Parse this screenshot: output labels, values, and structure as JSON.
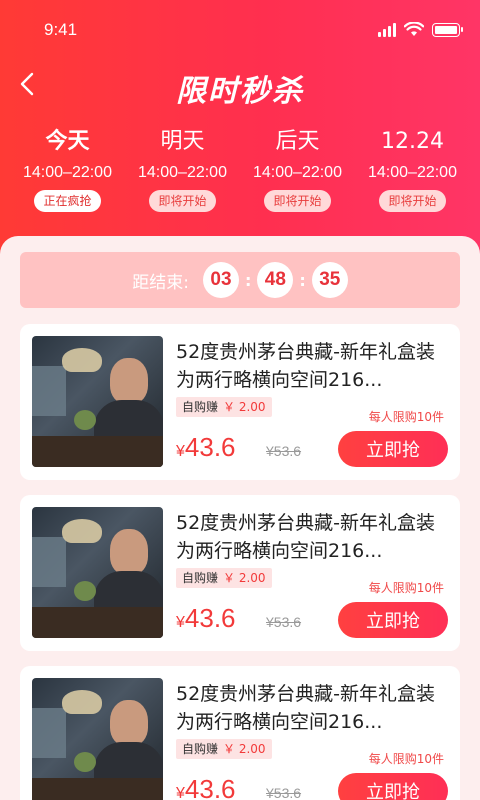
{
  "status_bar": {
    "time": "9:41"
  },
  "nav": {
    "title": "限时秒杀",
    "back_icon": "chevron-left-icon"
  },
  "date_tabs": [
    {
      "day": "今天",
      "time": "14:00–22:00",
      "tag": "正在疯抢",
      "active": true
    },
    {
      "day": "明天",
      "time": "14:00–22:00",
      "tag": "即将开始",
      "active": false
    },
    {
      "day": "后天",
      "time": "14:00–22:00",
      "tag": "即将开始",
      "active": false
    },
    {
      "day": "12.24",
      "time": "14:00–22:00",
      "tag": "即将开始",
      "active": false
    }
  ],
  "countdown": {
    "label": "距结束:",
    "hours": "03",
    "sep1": ":",
    "minutes": "48",
    "sep2": ":",
    "seconds": "35"
  },
  "products": [
    {
      "title_line1": "52度贵州茅台典藏-新年礼盒装",
      "title_line2": "为两行略横向空间216...",
      "earn_label": "自购赚",
      "earn_value": "￥ 2.00",
      "limit": "每人限购10件",
      "currency": "¥",
      "price": "43.6",
      "orig_price": "¥53.6",
      "buy_label": "立即抢"
    },
    {
      "title_line1": "52度贵州茅台典藏-新年礼盒装",
      "title_line2": "为两行略横向空间216...",
      "earn_label": "自购赚",
      "earn_value": "￥ 2.00",
      "limit": "每人限购10件",
      "currency": "¥",
      "price": "43.6",
      "orig_price": "¥53.6",
      "buy_label": "立即抢"
    },
    {
      "title_line1": "52度贵州茅台典藏-新年礼盒装",
      "title_line2": "为两行略横向空间216...",
      "earn_label": "自购赚",
      "earn_value": "￥ 2.00",
      "limit": "每人限购10件",
      "currency": "¥",
      "price": "43.6",
      "orig_price": "¥53.6",
      "buy_label": "立即抢"
    }
  ],
  "colors": {
    "brand": "#ff3a45",
    "price": "#f23a3a",
    "content_bg": "#fdeeee",
    "countdown_bg": "#ffc2c2"
  }
}
